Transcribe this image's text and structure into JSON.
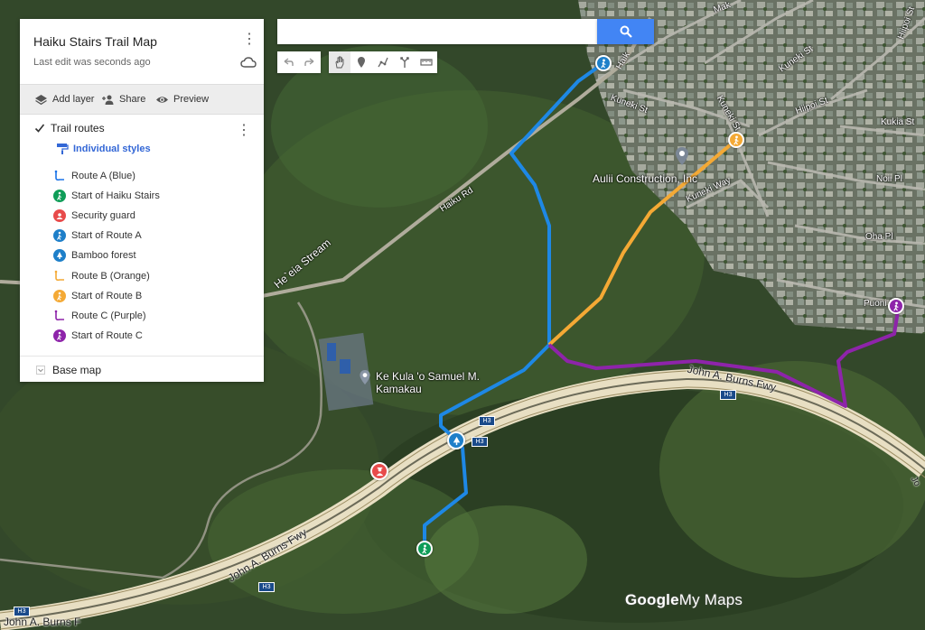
{
  "map": {
    "title": "Haiku Stairs Trail Map",
    "status": "Last edit was seconds ago",
    "actions": {
      "add_layer": "Add layer",
      "share": "Share",
      "preview": "Preview"
    },
    "layer": {
      "name": "Trail routes",
      "checked": true,
      "style_mode": "Individual styles",
      "items": [
        {
          "label": "Route A (Blue)",
          "icon": "route-line-icon",
          "color": "#1a73e8"
        },
        {
          "label": "Start of Haiku Stairs",
          "icon": "hiker-icon",
          "color": "#0f9d58"
        },
        {
          "label": "Security guard",
          "icon": "guard-icon",
          "color": "#e84b4b"
        },
        {
          "label": "Start of Route A",
          "icon": "hiker-icon",
          "color": "#1e7fc9"
        },
        {
          "label": "Bamboo forest",
          "icon": "tree-icon",
          "color": "#1e7fc9"
        },
        {
          "label": "Route B (Orange)",
          "icon": "route-line-icon",
          "color": "#f4a935"
        },
        {
          "label": "Start of Route B",
          "icon": "hiker-icon",
          "color": "#f4a935"
        },
        {
          "label": "Route C (Purple)",
          "icon": "route-line-icon",
          "color": "#8e24aa"
        },
        {
          "label": "Start of Route C",
          "icon": "hiker-icon",
          "color": "#8e24aa"
        }
      ]
    },
    "base_map": "Base map",
    "search": {
      "value": "",
      "placeholder": ""
    },
    "toolbar": [
      "undo-icon",
      "redo-icon",
      "hand-icon",
      "marker-icon",
      "line-icon",
      "directions-icon",
      "ruler-icon"
    ],
    "labels": {
      "haiku_rd": "Haiku Rd",
      "stream": "He`eia Stream",
      "school": "Ke Kula 'o Samuel M. Kamakau",
      "construction": "Aulii Construction, Inc",
      "fwy1": "John A. Burns Fwy",
      "fwy2": "John A. Burns Fwy",
      "fwy3": "John A. Burns F",
      "haiku_cut": "Haik",
      "kuneki_st1": "Kuneki St",
      "kuneki_st2": "Kuneki St",
      "kuneki_st3": "Kuneki St",
      "kuneki_way": "Kuneki Way",
      "hiipoi": "Hiipoi St",
      "hiipoi2": "Hiipoi St",
      "kukia": "Kukia St",
      "noii": "Noii Pl",
      "oha": "Oha Pl",
      "puoni": "Puoni Pl",
      "mak": "Mak",
      "jo": "Jo",
      "h3": "H3"
    },
    "colors": {
      "route_a": "#1e88e5",
      "route_b": "#f4a935",
      "route_c": "#8e24aa",
      "search_button": "#4285f4"
    },
    "logo": {
      "google": "Google",
      "mymaps": "My Maps"
    }
  }
}
